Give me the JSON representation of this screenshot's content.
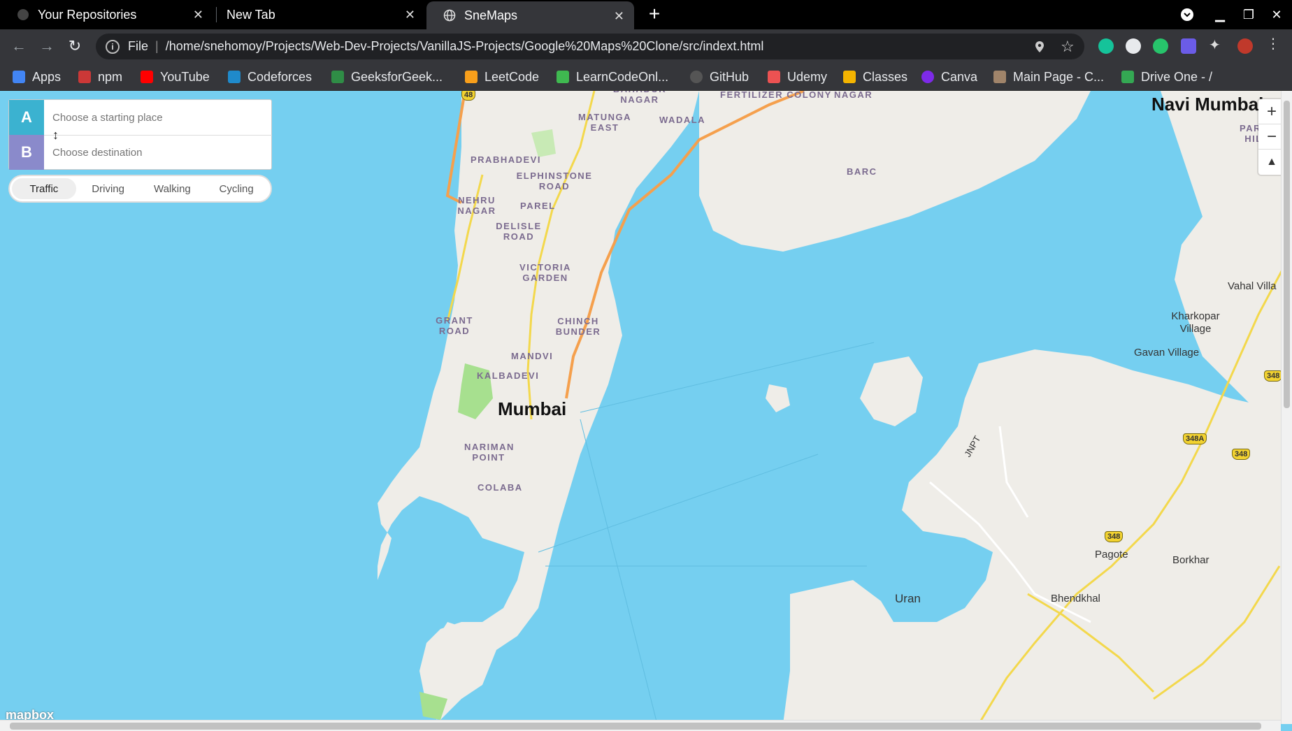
{
  "tabs": [
    {
      "title": "Your Repositories",
      "icon": "github-icon"
    },
    {
      "title": "New Tab",
      "icon": ""
    },
    {
      "title": "SneMaps",
      "icon": "globe-icon",
      "active": true
    }
  ],
  "toolbar": {
    "scheme": "File",
    "url": "/home/snehomoy/Projects/Web-Dev-Projects/VanillaJS-Projects/Google%20Maps%20Clone/src/indext.html"
  },
  "bookmarks": [
    {
      "label": "Apps",
      "icon": "apps-grid-icon",
      "color": "#4285f4"
    },
    {
      "label": "npm",
      "icon": "npm-icon",
      "color": "#cb3837"
    },
    {
      "label": "YouTube",
      "icon": "youtube-icon",
      "color": "#ff0000"
    },
    {
      "label": "Codeforces",
      "icon": "codeforces-icon",
      "color": "#1f8acb"
    },
    {
      "label": "GeeksforGeek...",
      "icon": "gfg-icon",
      "color": "#2f8d46"
    },
    {
      "label": "LeetCode",
      "icon": "leetcode-icon",
      "color": "#f89f1b"
    },
    {
      "label": "LearnCodeOnl...",
      "icon": "learncode-icon",
      "color": "#3fb950"
    },
    {
      "label": "GitHub",
      "icon": "github-icon",
      "color": "#555555"
    },
    {
      "label": "Udemy",
      "icon": "udemy-icon",
      "color": "#ec5252"
    },
    {
      "label": "Classes",
      "icon": "classroom-icon",
      "color": "#f4b400"
    },
    {
      "label": "Canva",
      "icon": "canva-icon",
      "color": "#7d2ae8"
    },
    {
      "label": "Main Page - C...",
      "icon": "page-icon",
      "color": "#a0846a"
    },
    {
      "label": "Drive One - /",
      "icon": "drive-icon",
      "color": "#34a853"
    }
  ],
  "directions": {
    "origin_marker": "A",
    "destination_marker": "B",
    "origin_placeholder": "Choose a starting place",
    "destination_placeholder": "Choose destination",
    "origin_color": "#3bb2d0",
    "destination_color": "#8a8acb"
  },
  "modes": [
    {
      "label": "Traffic",
      "active": true
    },
    {
      "label": "Driving"
    },
    {
      "label": "Walking"
    },
    {
      "label": "Cycling"
    }
  ],
  "map": {
    "city": "Mumbai",
    "neighborhoods": [
      "FERTILIZER COLONY",
      "NAGAR",
      "MATUNGA EAST",
      "WADALA",
      "BAHADUR NAGAR",
      "BARC",
      "PRABHADEVI",
      "ELPHINSTONE ROAD",
      "NEHRU NAGAR",
      "PAREL",
      "DELISLE ROAD",
      "VICTORIA GARDEN",
      "GRANT ROAD",
      "CHINCH BUNDER",
      "MANDVI",
      "KALBADEVI",
      "NARIMAN POINT",
      "COLABA"
    ],
    "places": [
      "Navi Mumbai",
      "PARS HIL",
      "Vahal Villa",
      "Kharkopar Village",
      "Gavan Village",
      "JNPT",
      "Pagote",
      "Borkhar",
      "Uran",
      "Bhendkhal"
    ],
    "shields": [
      "48",
      "348A",
      "348",
      "348",
      "348"
    ],
    "attribution": "mapbox"
  },
  "colors": {
    "water": "#75cff0",
    "land": "#efede8",
    "park": "#a7e08f",
    "highway": "#f5a04d",
    "primary_road": "#f3d84c"
  }
}
